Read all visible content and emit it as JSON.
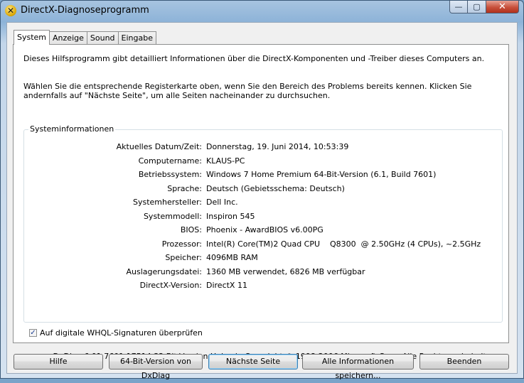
{
  "window": {
    "title": "DirectX-Diagnoseprogramm",
    "controls": {
      "minimize": "—",
      "maximize": "▢",
      "close": "✕"
    }
  },
  "tabs": [
    {
      "label": "System",
      "active": true
    },
    {
      "label": "Anzeige",
      "active": false
    },
    {
      "label": "Sound",
      "active": false
    },
    {
      "label": "Eingabe",
      "active": false
    }
  ],
  "intro": {
    "line1": "Dieses Hilfsprogramm gibt detailliert Informationen über die DirectX-Komponenten und -Treiber dieses Computers an.",
    "line2": "Wählen Sie die entsprechende Registerkarte oben, wenn Sie den Bereich des Problems bereits kennen. Klicken Sie andernfalls auf \"Nächste Seite\", um alle Seiten nacheinander zu durchsuchen."
  },
  "sysinfo": {
    "title": "Systeminformationen",
    "rows": [
      {
        "label": "Aktuelles Datum/Zeit:",
        "value": "Donnerstag, 19. Juni 2014, 10:53:39"
      },
      {
        "label": "Computername:",
        "value": "KLAUS-PC"
      },
      {
        "label": "Betriebssystem:",
        "value": "Windows 7 Home Premium 64-Bit-Version (6.1, Build 7601)"
      },
      {
        "label": "Sprache:",
        "value": "Deutsch (Gebietsschema: Deutsch)"
      },
      {
        "label": "Systemhersteller:",
        "value": "Dell Inc."
      },
      {
        "label": "Systemmodell:",
        "value": "Inspiron 545"
      },
      {
        "label": "BIOS:",
        "value": "Phoenix - AwardBIOS v6.00PG"
      },
      {
        "label": "Prozessor:",
        "value": "Intel(R) Core(TM)2 Quad CPU    Q8300  @ 2.50GHz (4 CPUs), ~2.5GHz"
      },
      {
        "label": "Speicher:",
        "value": "4096MB RAM"
      },
      {
        "label": "Auslagerungsdatei:",
        "value": "1360 MB verwendet, 6826 MB verfügbar"
      },
      {
        "label": "DirectX-Version:",
        "value": "DirectX 11"
      }
    ]
  },
  "whql": {
    "label": "Auf digitale WHQL-Signaturen überprüfen",
    "checked": true,
    "check_glyph": "✓"
  },
  "copyright": "DxDiag 6.01.7601.17514 32-Bit-Version Unicode Copyright © 1998-2006 Microsoft Corp. Alle Rechte vorbehalten.",
  "buttons": {
    "help": "Hilfe",
    "dxdiag64": "64-Bit-Version von DxDiag",
    "next": "Nächste Seite",
    "save_all": "Alle Informationen speichern...",
    "exit": "Beenden"
  },
  "icons": {
    "app": "directx-icon"
  }
}
